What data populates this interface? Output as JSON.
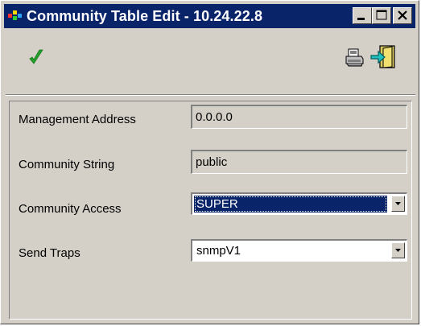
{
  "window": {
    "title": "Community Table Edit - 10.24.22.8"
  },
  "titlebar_buttons": [
    {
      "name": "minimize",
      "icon": "minimize-icon"
    },
    {
      "name": "maximize",
      "icon": "maximize-icon"
    },
    {
      "name": "close",
      "icon": "close-icon"
    }
  ],
  "toolbar": {
    "apply_icon": "checkmark-icon",
    "print_icon": "printer-icon",
    "exit_icon": "exit-door-icon"
  },
  "form": {
    "management_address": {
      "label": "Management Address",
      "value": "0.0.0.0"
    },
    "community_string": {
      "label": "Community String",
      "value": "public"
    },
    "community_access": {
      "label": "Community Access",
      "value": "SUPER"
    },
    "send_traps": {
      "label": "Send Traps",
      "value": "snmpV1"
    }
  },
  "colors": {
    "titlebar": "#0a246a",
    "face": "#d4d0c8",
    "selection": "#0a246a",
    "check_green": "#22a02a"
  }
}
